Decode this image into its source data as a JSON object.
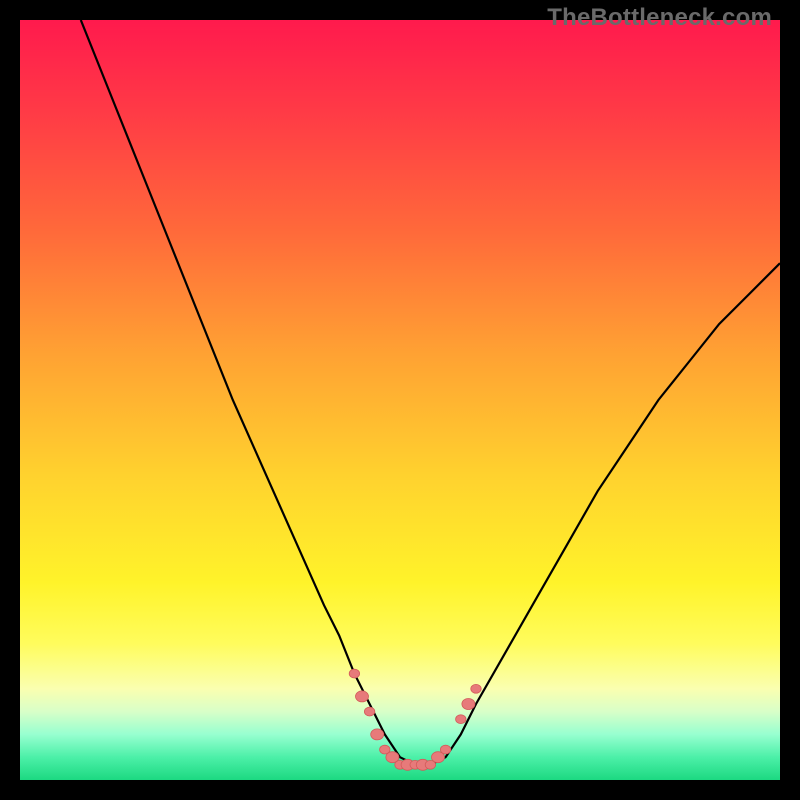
{
  "watermark": "TheBottleneck.com",
  "colors": {
    "background": "#000000",
    "curve": "#000000",
    "marker_fill": "#e77a7a",
    "marker_stroke": "#d35a5a",
    "gradient_top": "#ff1a4d",
    "gradient_bottom": "#1cd981"
  },
  "chart_data": {
    "type": "line",
    "title": "",
    "xlabel": "",
    "ylabel": "",
    "xlim": [
      0,
      100
    ],
    "ylim": [
      0,
      100
    ],
    "grid": false,
    "series": [
      {
        "name": "v-curve",
        "x": [
          8,
          12,
          16,
          20,
          24,
          28,
          32,
          36,
          40,
          42,
          44,
          46,
          48,
          50,
          52,
          54,
          56,
          58,
          60,
          64,
          68,
          72,
          76,
          80,
          84,
          88,
          92,
          96,
          100
        ],
        "y": [
          100,
          90,
          80,
          70,
          60,
          50,
          41,
          32,
          23,
          19,
          14,
          10,
          6,
          3,
          2,
          2,
          3,
          6,
          10,
          17,
          24,
          31,
          38,
          44,
          50,
          55,
          60,
          64,
          68
        ]
      }
    ],
    "markers": [
      {
        "x": 44,
        "y": 14,
        "r": 4
      },
      {
        "x": 45,
        "y": 11,
        "r": 5
      },
      {
        "x": 46,
        "y": 9,
        "r": 4
      },
      {
        "x": 47,
        "y": 6,
        "r": 5
      },
      {
        "x": 48,
        "y": 4,
        "r": 4
      },
      {
        "x": 49,
        "y": 3,
        "r": 5
      },
      {
        "x": 50,
        "y": 2,
        "r": 4
      },
      {
        "x": 51,
        "y": 2,
        "r": 5
      },
      {
        "x": 52,
        "y": 2,
        "r": 4
      },
      {
        "x": 53,
        "y": 2,
        "r": 5
      },
      {
        "x": 54,
        "y": 2,
        "r": 4
      },
      {
        "x": 55,
        "y": 3,
        "r": 5
      },
      {
        "x": 56,
        "y": 4,
        "r": 4
      },
      {
        "x": 58,
        "y": 8,
        "r": 4
      },
      {
        "x": 59,
        "y": 10,
        "r": 5
      },
      {
        "x": 60,
        "y": 12,
        "r": 4
      }
    ]
  }
}
